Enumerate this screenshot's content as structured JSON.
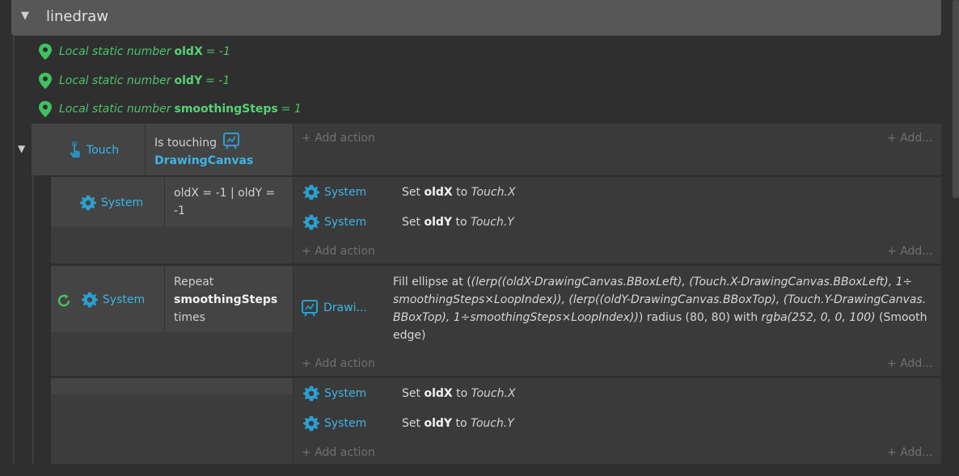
{
  "group": {
    "title": "linedraw"
  },
  "variables": [
    {
      "prefix": "Local static number",
      "name": "oldX",
      "suffix": "= -1"
    },
    {
      "prefix": "Local static number",
      "name": "oldY",
      "suffix": "= -1"
    },
    {
      "prefix": "Local static number",
      "name": "smoothingSteps",
      "suffix": "= 1"
    }
  ],
  "event_touch": {
    "object": "Touch",
    "condition_text": "Is touching",
    "condition_object": "DrawingCanvas",
    "add_action": "Add action",
    "add_more": "Add..."
  },
  "sub1": {
    "object": "System",
    "condition": "oldX = -1 | oldY = -1",
    "actions": [
      {
        "object": "System",
        "verb": "Set",
        "var": "oldX",
        "mid": "to",
        "expr": "Touch.X"
      },
      {
        "object": "System",
        "verb": "Set",
        "var": "oldY",
        "mid": "to",
        "expr": "Touch.Y"
      }
    ],
    "add_action": "Add action",
    "add_more": "Add..."
  },
  "sub2": {
    "object": "System",
    "cond_line1": "Repeat",
    "cond_var": "smoothingSteps",
    "cond_line3": "times",
    "action_object": "Drawi...",
    "action_lead": "Fill ellipse at (",
    "action_expr1": "(lerp((oldX-DrawingCanvas.BBoxLeft), (Touch.X-DrawingCanvas.BBoxLeft), 1÷",
    "action_expr2": "smoothingSteps×LoopIndex)), (lerp((oldY-DrawingCanvas.BBoxTop), (Touch.Y-DrawingCanvas.",
    "action_expr3": "BBoxTop), 1÷smoothingSteps×LoopIndex))",
    "action_mid": ") radius (80, 80) with",
    "action_color": "rgba(252, 0, 0, 100)",
    "action_tail": "(Smooth",
    "action_tail2": "edge)",
    "add_action": "Add action",
    "add_more": "Add..."
  },
  "sub3": {
    "actions": [
      {
        "object": "System",
        "verb": "Set",
        "var": "oldX",
        "mid": "to",
        "expr": "Touch.X"
      },
      {
        "object": "System",
        "verb": "Set",
        "var": "oldY",
        "mid": "to",
        "expr": "Touch.Y"
      }
    ],
    "add_action": "Add action",
    "add_more": "Add..."
  },
  "icons": {
    "pin": "location-pin-icon",
    "gear": "gear-icon",
    "touch": "touch-hand-icon",
    "canvas": "drawing-canvas-icon",
    "loop": "loop-icon"
  },
  "colors": {
    "var_green": "#4cc36a",
    "object_blue": "#3eb4e6",
    "header_bg": "#575757"
  }
}
